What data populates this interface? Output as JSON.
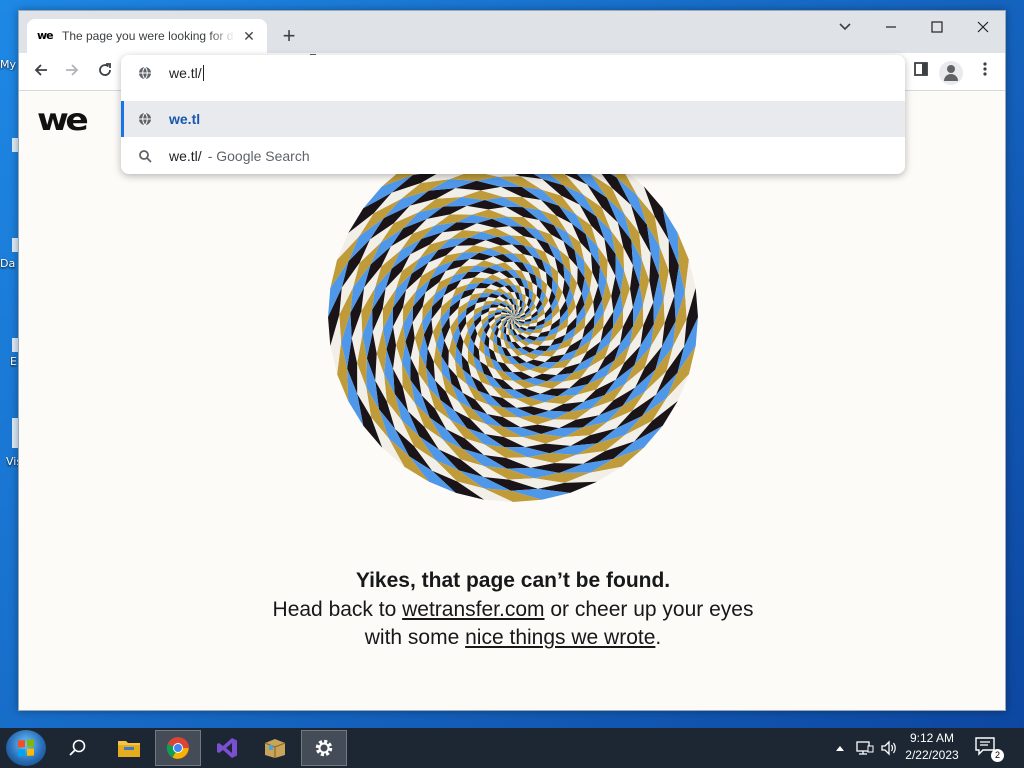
{
  "desktop": {
    "labels": [
      "My",
      "Da",
      "E",
      "Vis"
    ]
  },
  "browser": {
    "tab": {
      "favicon": "we",
      "title": "The page you were looking for doesn't exist"
    },
    "address_bar": {
      "value": "we.tl/"
    },
    "suggestions": [
      {
        "type": "url",
        "text": "we.tl",
        "sub": ""
      },
      {
        "type": "search",
        "text": "we.tl/",
        "sub": "- Google Search"
      }
    ]
  },
  "page": {
    "logo": "we",
    "headline": "Yikes, that page can’t be found.",
    "text_1": "Head back to ",
    "link_1": "wetransfer.com",
    "text_2": " or cheer up your eyes with some ",
    "link_2": "nice things we wrote",
    "text_3": ".",
    "spiral_colors": [
      "#1a1418",
      "#f2efe8",
      "#4f97e8",
      "#bf9b3a"
    ]
  },
  "taskbar": {
    "time": "9:12 AM",
    "date": "2/22/2023",
    "notification_count": "2"
  }
}
